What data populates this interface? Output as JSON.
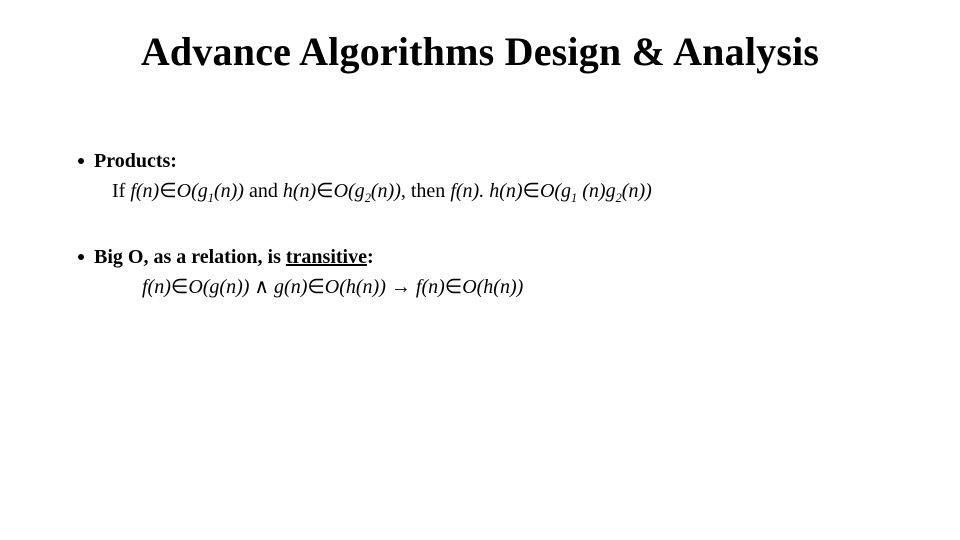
{
  "title": "Advance Algorithms Design & Analysis",
  "b1": {
    "heading": "Products:",
    "if": "If ",
    "fn": "f(n)",
    "in": "∈",
    "Og1_open": "O(g",
    "s1": "1",
    "n_close": "(n))",
    "and": " and ",
    "hn": "h(n)",
    "Og2_open": "O(g",
    "s2": "2",
    "then": ", then  ",
    "fn_dot_hn": "f(n). h(n)",
    "Og1_sp_open": "O(g",
    "ng_open": " (n)g"
  },
  "b2": {
    "heading_a": "Big O, as a relation, is ",
    "heading_b": "transitive",
    "colon": ":",
    "fn": "f(n)",
    "in": "∈",
    "Ogn": "O(g(n))",
    "and": " ∧ ",
    "gn": "g(n)",
    "Ohn": "O(h(n))",
    "imp": " → "
  }
}
